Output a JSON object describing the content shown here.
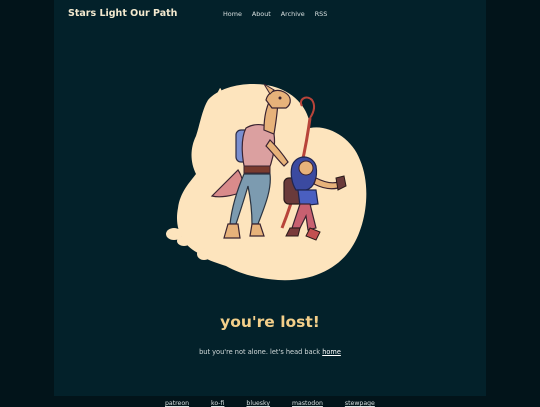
{
  "header": {
    "site_title": "Stars Light Our Path",
    "nav": [
      "Home",
      "About",
      "Archive",
      "RSS"
    ]
  },
  "main": {
    "heading": "you're lost!",
    "message": "but you're not alone. let's head back",
    "home_link": "home"
  },
  "footer": {
    "links": [
      "patreon",
      "ko-fi",
      "bluesky",
      "mastodon",
      "stewpage"
    ]
  },
  "illustration": {
    "icon": "lost-travelers-illustration",
    "blob_color": "#fde4bd"
  }
}
